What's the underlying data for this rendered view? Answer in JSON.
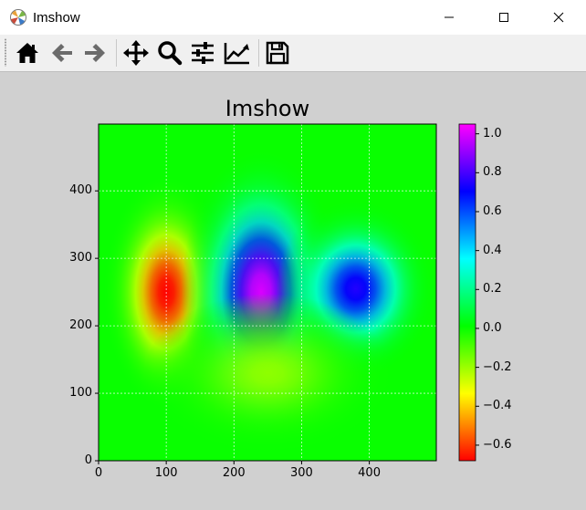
{
  "window": {
    "title": "Imshow",
    "controls": [
      "minimize",
      "maximize",
      "close"
    ]
  },
  "toolbar": {
    "tools": [
      {
        "name": "home-icon"
      },
      {
        "name": "back-arrow-icon"
      },
      {
        "name": "forward-arrow-icon"
      },
      {
        "name": "pan-icon"
      },
      {
        "name": "zoom-icon"
      },
      {
        "name": "subplots-config-icon"
      },
      {
        "name": "edit-axes-icon"
      },
      {
        "name": "save-icon"
      }
    ]
  },
  "chart_data": {
    "type": "heatmap",
    "title": "Imshow",
    "colormap": "gist_rainbow-like (red → yellow → green → cyan → blue → magenta)",
    "colormap_stops": [
      "#ff0000",
      "#ffff00",
      "#00ff00",
      "#00ffff",
      "#0000ff",
      "#ff00ff"
    ],
    "background_value": 0.0,
    "xlim": [
      0,
      499
    ],
    "ylim": [
      0,
      499
    ],
    "x_ticks": [
      0,
      100,
      200,
      300,
      400
    ],
    "y_ticks": [
      0,
      100,
      200,
      300,
      400
    ],
    "colorbar": {
      "range": [
        -0.68,
        1.05
      ],
      "ticks": [
        "1.0",
        "0.8",
        "0.6",
        "0.4",
        "0.2",
        "0.0",
        "−0.2",
        "−0.4",
        "−0.6"
      ]
    },
    "features": [
      {
        "x": 100,
        "y": 250,
        "value": -0.68,
        "sx": 35,
        "sy": 65
      },
      {
        "x": 240,
        "y": 250,
        "value": 1.0,
        "sx": 45,
        "sy": 80
      },
      {
        "x": 380,
        "y": 255,
        "value": 0.75,
        "sx": 45,
        "sy": 50
      },
      {
        "x": 250,
        "y": 130,
        "value": -0.18,
        "sx": 70,
        "sy": 45
      }
    ],
    "grid": true,
    "origin": "lower"
  }
}
